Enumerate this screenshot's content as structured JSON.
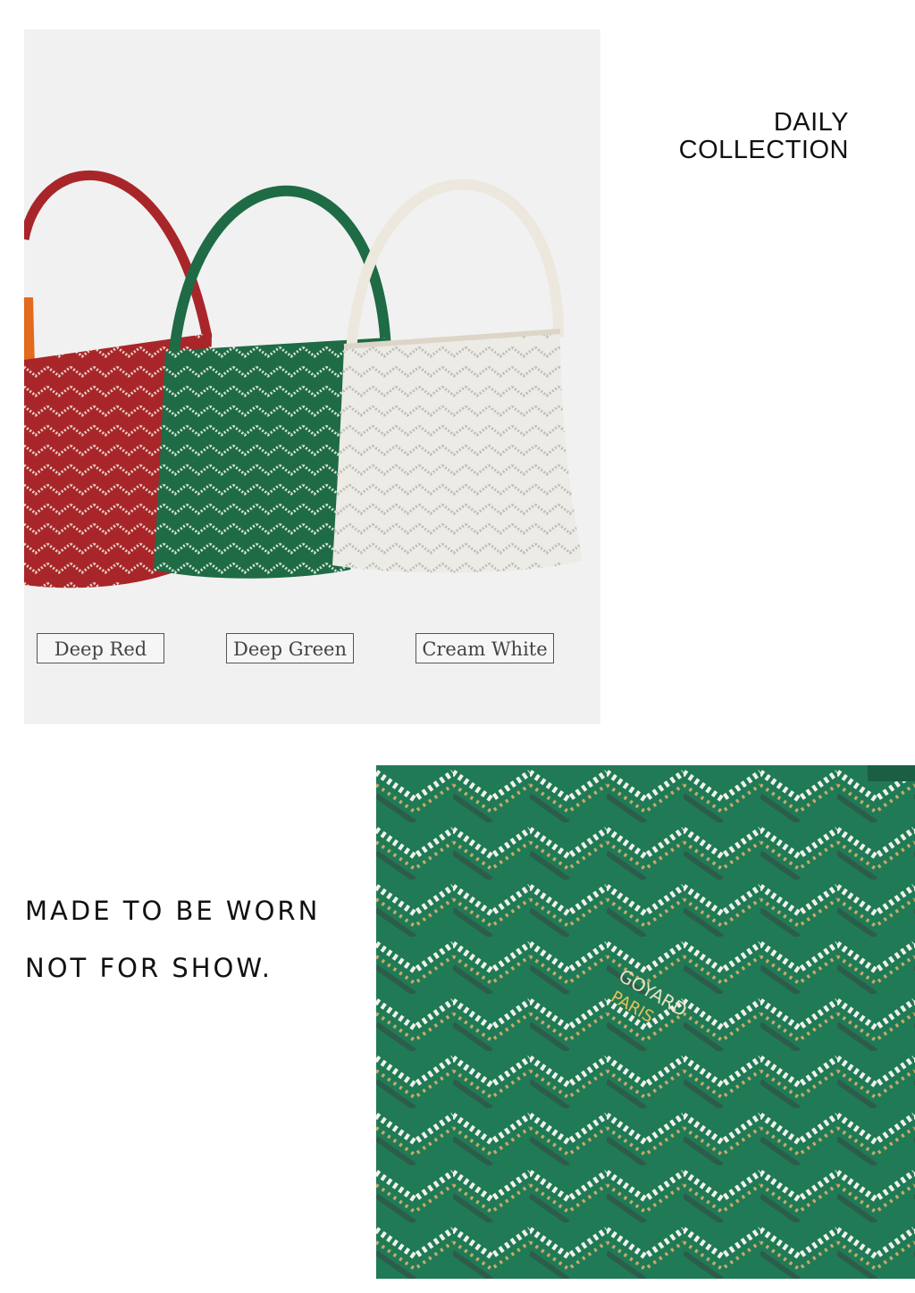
{
  "header": {
    "line1": "DAILY",
    "line2": "COLLECTION"
  },
  "product_photo": {
    "colors": [
      {
        "label": "Deep Red",
        "hex": "#a8262a"
      },
      {
        "label": "Deep Green",
        "hex": "#1e6b45"
      },
      {
        "label": "Cream White",
        "hex": "#ece8dd"
      }
    ]
  },
  "tagline": {
    "line1": "MADE TO BE WORN",
    "line2": "NOT FOR SHOW."
  },
  "detail_photo": {
    "stamp_text": [
      "GOYARD",
      "PARIS"
    ],
    "base_color": "#1f7a55"
  }
}
